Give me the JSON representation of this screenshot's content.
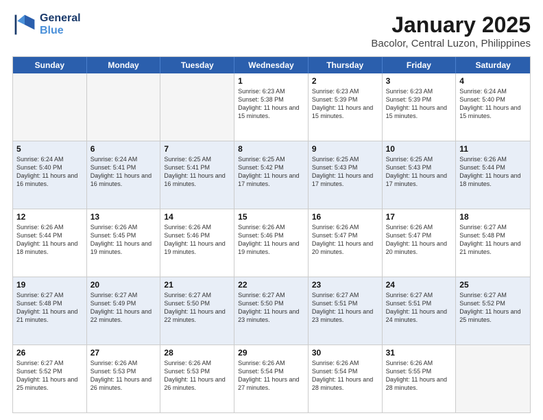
{
  "header": {
    "logo_line1": "General",
    "logo_line2": "Blue",
    "month": "January 2025",
    "location": "Bacolor, Central Luzon, Philippines"
  },
  "weekdays": [
    "Sunday",
    "Monday",
    "Tuesday",
    "Wednesday",
    "Thursday",
    "Friday",
    "Saturday"
  ],
  "rows": [
    {
      "alt": false,
      "cells": [
        {
          "day": "",
          "info": ""
        },
        {
          "day": "",
          "info": ""
        },
        {
          "day": "",
          "info": ""
        },
        {
          "day": "1",
          "info": "Sunrise: 6:23 AM\nSunset: 5:38 PM\nDaylight: 11 hours and 15 minutes."
        },
        {
          "day": "2",
          "info": "Sunrise: 6:23 AM\nSunset: 5:39 PM\nDaylight: 11 hours and 15 minutes."
        },
        {
          "day": "3",
          "info": "Sunrise: 6:23 AM\nSunset: 5:39 PM\nDaylight: 11 hours and 15 minutes."
        },
        {
          "day": "4",
          "info": "Sunrise: 6:24 AM\nSunset: 5:40 PM\nDaylight: 11 hours and 15 minutes."
        }
      ]
    },
    {
      "alt": true,
      "cells": [
        {
          "day": "5",
          "info": "Sunrise: 6:24 AM\nSunset: 5:40 PM\nDaylight: 11 hours and 16 minutes."
        },
        {
          "day": "6",
          "info": "Sunrise: 6:24 AM\nSunset: 5:41 PM\nDaylight: 11 hours and 16 minutes."
        },
        {
          "day": "7",
          "info": "Sunrise: 6:25 AM\nSunset: 5:41 PM\nDaylight: 11 hours and 16 minutes."
        },
        {
          "day": "8",
          "info": "Sunrise: 6:25 AM\nSunset: 5:42 PM\nDaylight: 11 hours and 17 minutes."
        },
        {
          "day": "9",
          "info": "Sunrise: 6:25 AM\nSunset: 5:43 PM\nDaylight: 11 hours and 17 minutes."
        },
        {
          "day": "10",
          "info": "Sunrise: 6:25 AM\nSunset: 5:43 PM\nDaylight: 11 hours and 17 minutes."
        },
        {
          "day": "11",
          "info": "Sunrise: 6:26 AM\nSunset: 5:44 PM\nDaylight: 11 hours and 18 minutes."
        }
      ]
    },
    {
      "alt": false,
      "cells": [
        {
          "day": "12",
          "info": "Sunrise: 6:26 AM\nSunset: 5:44 PM\nDaylight: 11 hours and 18 minutes."
        },
        {
          "day": "13",
          "info": "Sunrise: 6:26 AM\nSunset: 5:45 PM\nDaylight: 11 hours and 19 minutes."
        },
        {
          "day": "14",
          "info": "Sunrise: 6:26 AM\nSunset: 5:46 PM\nDaylight: 11 hours and 19 minutes."
        },
        {
          "day": "15",
          "info": "Sunrise: 6:26 AM\nSunset: 5:46 PM\nDaylight: 11 hours and 19 minutes."
        },
        {
          "day": "16",
          "info": "Sunrise: 6:26 AM\nSunset: 5:47 PM\nDaylight: 11 hours and 20 minutes."
        },
        {
          "day": "17",
          "info": "Sunrise: 6:26 AM\nSunset: 5:47 PM\nDaylight: 11 hours and 20 minutes."
        },
        {
          "day": "18",
          "info": "Sunrise: 6:27 AM\nSunset: 5:48 PM\nDaylight: 11 hours and 21 minutes."
        }
      ]
    },
    {
      "alt": true,
      "cells": [
        {
          "day": "19",
          "info": "Sunrise: 6:27 AM\nSunset: 5:48 PM\nDaylight: 11 hours and 21 minutes."
        },
        {
          "day": "20",
          "info": "Sunrise: 6:27 AM\nSunset: 5:49 PM\nDaylight: 11 hours and 22 minutes."
        },
        {
          "day": "21",
          "info": "Sunrise: 6:27 AM\nSunset: 5:50 PM\nDaylight: 11 hours and 22 minutes."
        },
        {
          "day": "22",
          "info": "Sunrise: 6:27 AM\nSunset: 5:50 PM\nDaylight: 11 hours and 23 minutes."
        },
        {
          "day": "23",
          "info": "Sunrise: 6:27 AM\nSunset: 5:51 PM\nDaylight: 11 hours and 23 minutes."
        },
        {
          "day": "24",
          "info": "Sunrise: 6:27 AM\nSunset: 5:51 PM\nDaylight: 11 hours and 24 minutes."
        },
        {
          "day": "25",
          "info": "Sunrise: 6:27 AM\nSunset: 5:52 PM\nDaylight: 11 hours and 25 minutes."
        }
      ]
    },
    {
      "alt": false,
      "cells": [
        {
          "day": "26",
          "info": "Sunrise: 6:27 AM\nSunset: 5:52 PM\nDaylight: 11 hours and 25 minutes."
        },
        {
          "day": "27",
          "info": "Sunrise: 6:26 AM\nSunset: 5:53 PM\nDaylight: 11 hours and 26 minutes."
        },
        {
          "day": "28",
          "info": "Sunrise: 6:26 AM\nSunset: 5:53 PM\nDaylight: 11 hours and 26 minutes."
        },
        {
          "day": "29",
          "info": "Sunrise: 6:26 AM\nSunset: 5:54 PM\nDaylight: 11 hours and 27 minutes."
        },
        {
          "day": "30",
          "info": "Sunrise: 6:26 AM\nSunset: 5:54 PM\nDaylight: 11 hours and 28 minutes."
        },
        {
          "day": "31",
          "info": "Sunrise: 6:26 AM\nSunset: 5:55 PM\nDaylight: 11 hours and 28 minutes."
        },
        {
          "day": "",
          "info": ""
        }
      ]
    }
  ]
}
